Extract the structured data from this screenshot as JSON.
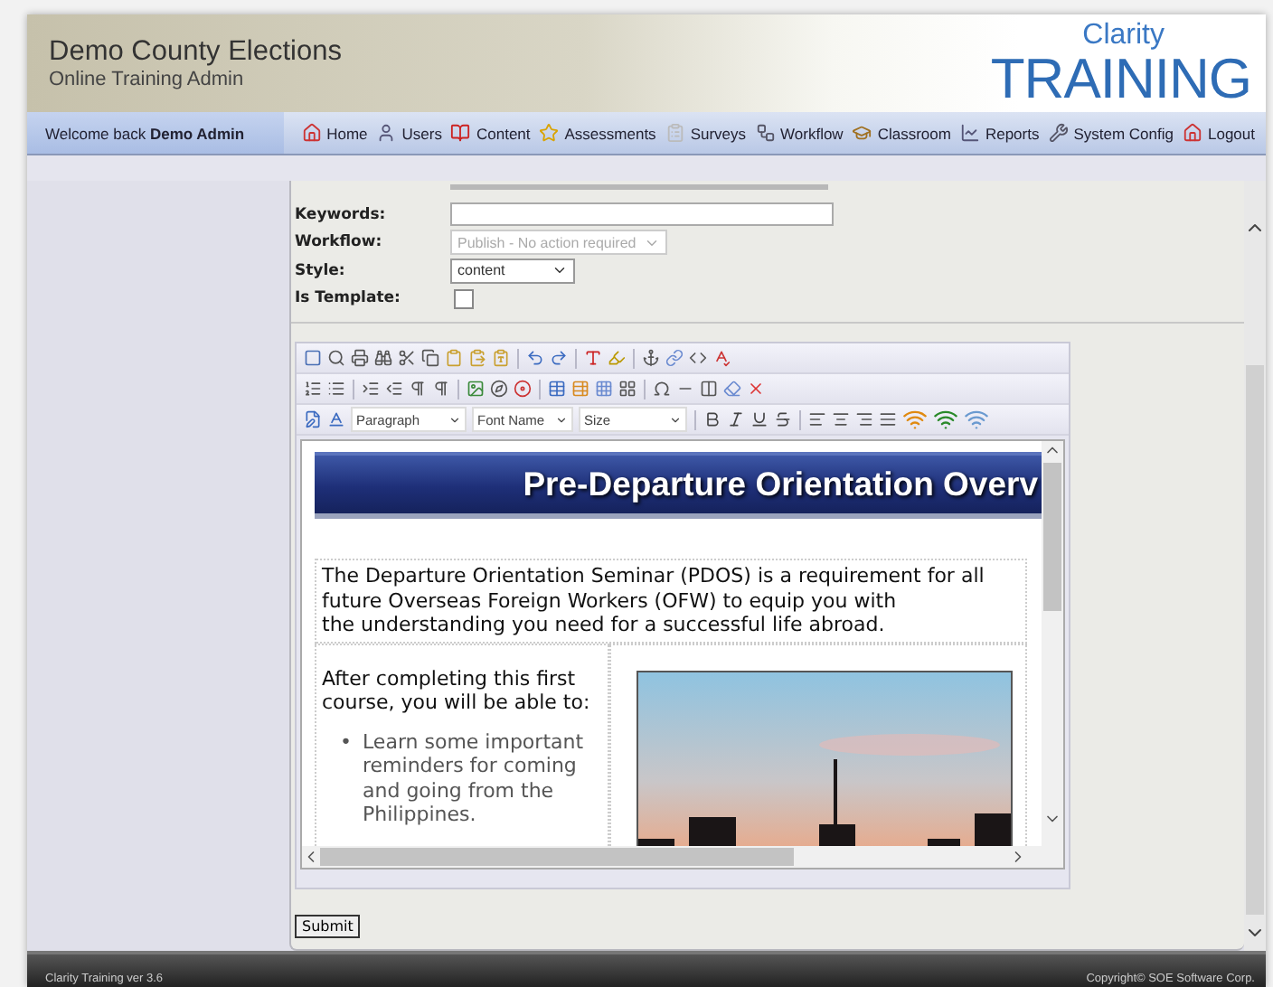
{
  "header": {
    "title": "Demo County Elections",
    "subtitle": "Online Training Admin",
    "logo_top": "Clarity",
    "logo_bottom": "TRAINING"
  },
  "nav": {
    "welcome_prefix": "Welcome back",
    "welcome_name": "Demo Admin",
    "items": [
      {
        "label": "Home"
      },
      {
        "label": "Users"
      },
      {
        "label": "Content"
      },
      {
        "label": "Assessments"
      },
      {
        "label": "Surveys"
      },
      {
        "label": "Workflow"
      },
      {
        "label": "Classroom"
      },
      {
        "label": "Reports"
      },
      {
        "label": "System Config"
      }
    ],
    "logout": "Logout"
  },
  "form": {
    "fields": [
      {
        "kind": "text",
        "label": "Keywords:"
      },
      {
        "kind": "select",
        "label": "Workflow:",
        "value": "Publish - No action required",
        "disabled": true
      },
      {
        "kind": "select",
        "label": "Style:",
        "value": "content",
        "disabled": false
      },
      {
        "kind": "checkbox",
        "label": "Is Template:",
        "checked": false
      }
    ]
  },
  "editor": {
    "dropdowns": [
      "Paragraph",
      "Font Name",
      "Size"
    ],
    "content": {
      "banner": "Pre-Departure Orientation Overv",
      "intro_lines": [
        "The Departure Orientation Seminar (PDOS) is a requirement for all",
        "future Overseas Foreign Workers (OFW) to equip you with",
        "the understanding you need for a successful life abroad."
      ],
      "left_text": "After completing this first course, you will be able to:",
      "bullets": [
        {
          "marker": "•",
          "text": "Learn some important reminders for coming and going from the Philippines."
        }
      ],
      "picture": {
        "kind": "picture"
      }
    }
  },
  "submit": "Submit",
  "footer": {
    "version": "Clarity Training ver 3.6",
    "copyright": "Copyright© SOE Software Corp."
  }
}
